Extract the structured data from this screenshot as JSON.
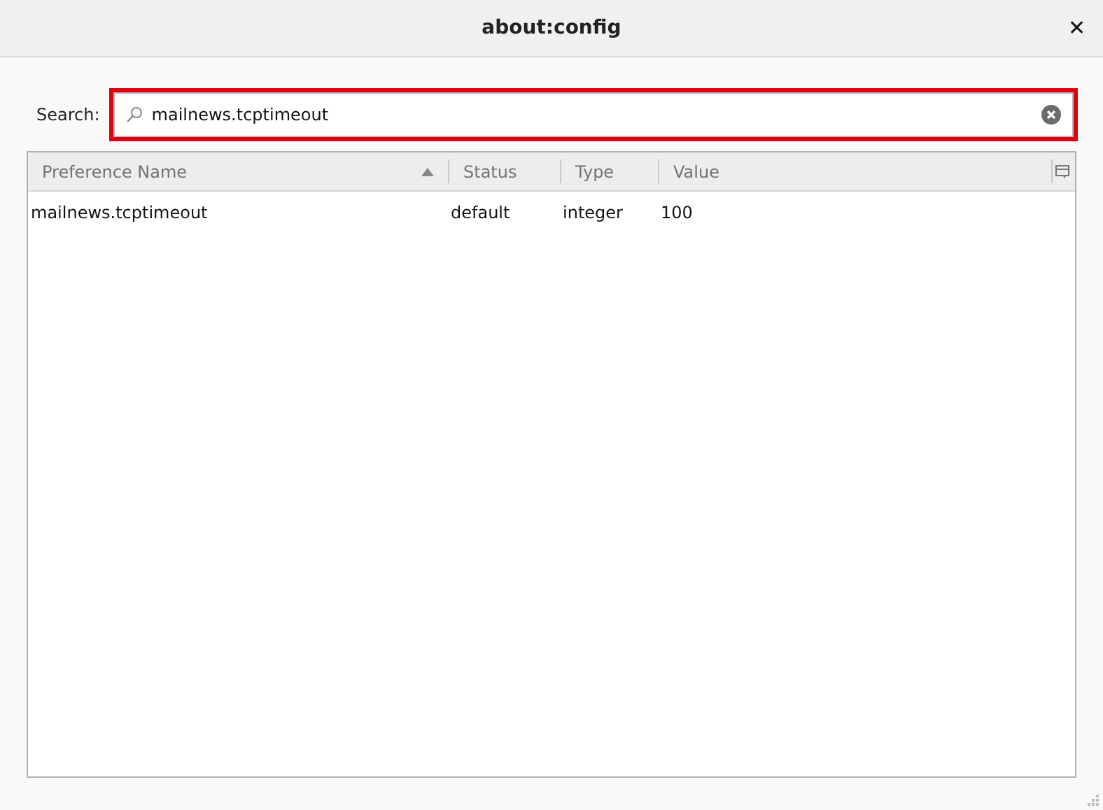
{
  "window": {
    "title": "about:config",
    "close": "✕"
  },
  "search": {
    "label": "Search:",
    "value": "mailnews.tcptimeout",
    "highlighted": true
  },
  "table": {
    "columns": [
      {
        "label": "Preference Name",
        "sorted": true
      },
      {
        "label": "Status",
        "sorted": false
      },
      {
        "label": "Type",
        "sorted": false
      },
      {
        "label": "Value",
        "sorted": false
      }
    ],
    "rows": [
      {
        "cells": [
          "mailnews.tcptimeout",
          "default",
          "integer",
          "100"
        ]
      }
    ]
  }
}
